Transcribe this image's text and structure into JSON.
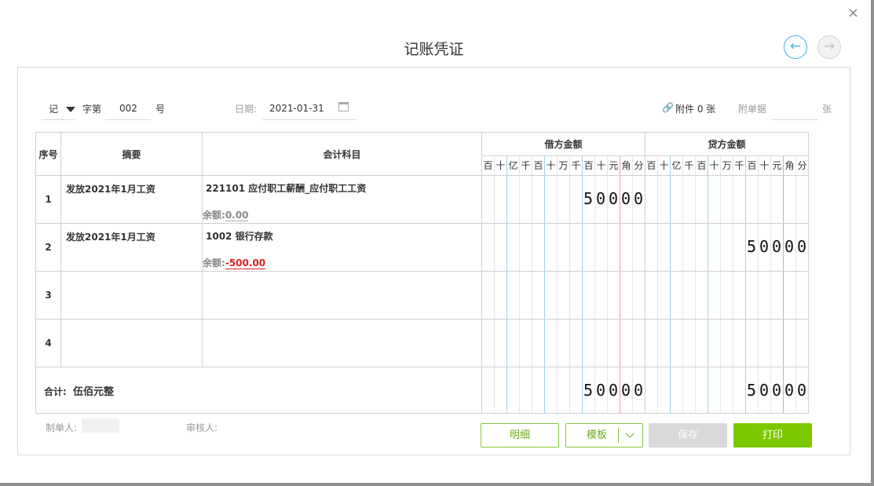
{
  "dialog": {
    "title": "记账凭证",
    "close_icon": "×",
    "prev_icon": "←",
    "next_icon": "→"
  },
  "voucher_header": {
    "word": "记",
    "zi_label": "字第",
    "number": "002",
    "hao_label": "号",
    "date_label": "日期:",
    "date_value": "2021-01-31",
    "attachment_label": "附件 0 张",
    "attach_docs_label": "附单据",
    "attach_docs_value": "",
    "zhang_label": "张"
  },
  "table": {
    "headers": {
      "seq": "序号",
      "summary": "摘要",
      "subject": "会计科目",
      "debit": "借方金额",
      "credit": "贷方金额"
    },
    "units": [
      "百",
      "十",
      "亿",
      "千",
      "百",
      "十",
      "万",
      "千",
      "百",
      "十",
      "元",
      "角",
      "分"
    ],
    "rows": [
      {
        "seq": "1",
        "summary": "发放2021年1月工资",
        "subject": "221101 应付职工薪酬_应付职工工资",
        "balance_label": "余额:",
        "balance": "0.00",
        "debit_digits": [
          "5",
          "0",
          "0",
          "0",
          "0"
        ],
        "credit_digits": []
      },
      {
        "seq": "2",
        "summary": "发放2021年1月工资",
        "subject": "1002 银行存款",
        "balance_label": "余额:",
        "balance": "-500.00",
        "debit_digits": [],
        "credit_digits": [
          "5",
          "0",
          "0",
          "0",
          "0"
        ]
      },
      {
        "seq": "3",
        "summary": "",
        "subject": "",
        "balance_label": "",
        "balance": "",
        "debit_digits": [],
        "credit_digits": []
      },
      {
        "seq": "4",
        "summary": "",
        "subject": "",
        "balance_label": "",
        "balance": "",
        "debit_digits": [],
        "credit_digits": []
      }
    ],
    "total": {
      "label": "合计:",
      "amount_words": "伍佰元整",
      "debit_digits": [
        "5",
        "0",
        "0",
        "0",
        "0"
      ],
      "credit_digits": [
        "5",
        "0",
        "0",
        "0",
        "0"
      ]
    }
  },
  "footer": {
    "maker_label": "制单人:",
    "reviewer_label": "审核人:",
    "detail_button": "明细",
    "template_button": "模板",
    "save_button": "保存",
    "print_button": "打印"
  },
  "colors": {
    "accent_green": "#7cc800",
    "accent_blue": "#3fb4ea",
    "negative_red": "#e02020"
  }
}
